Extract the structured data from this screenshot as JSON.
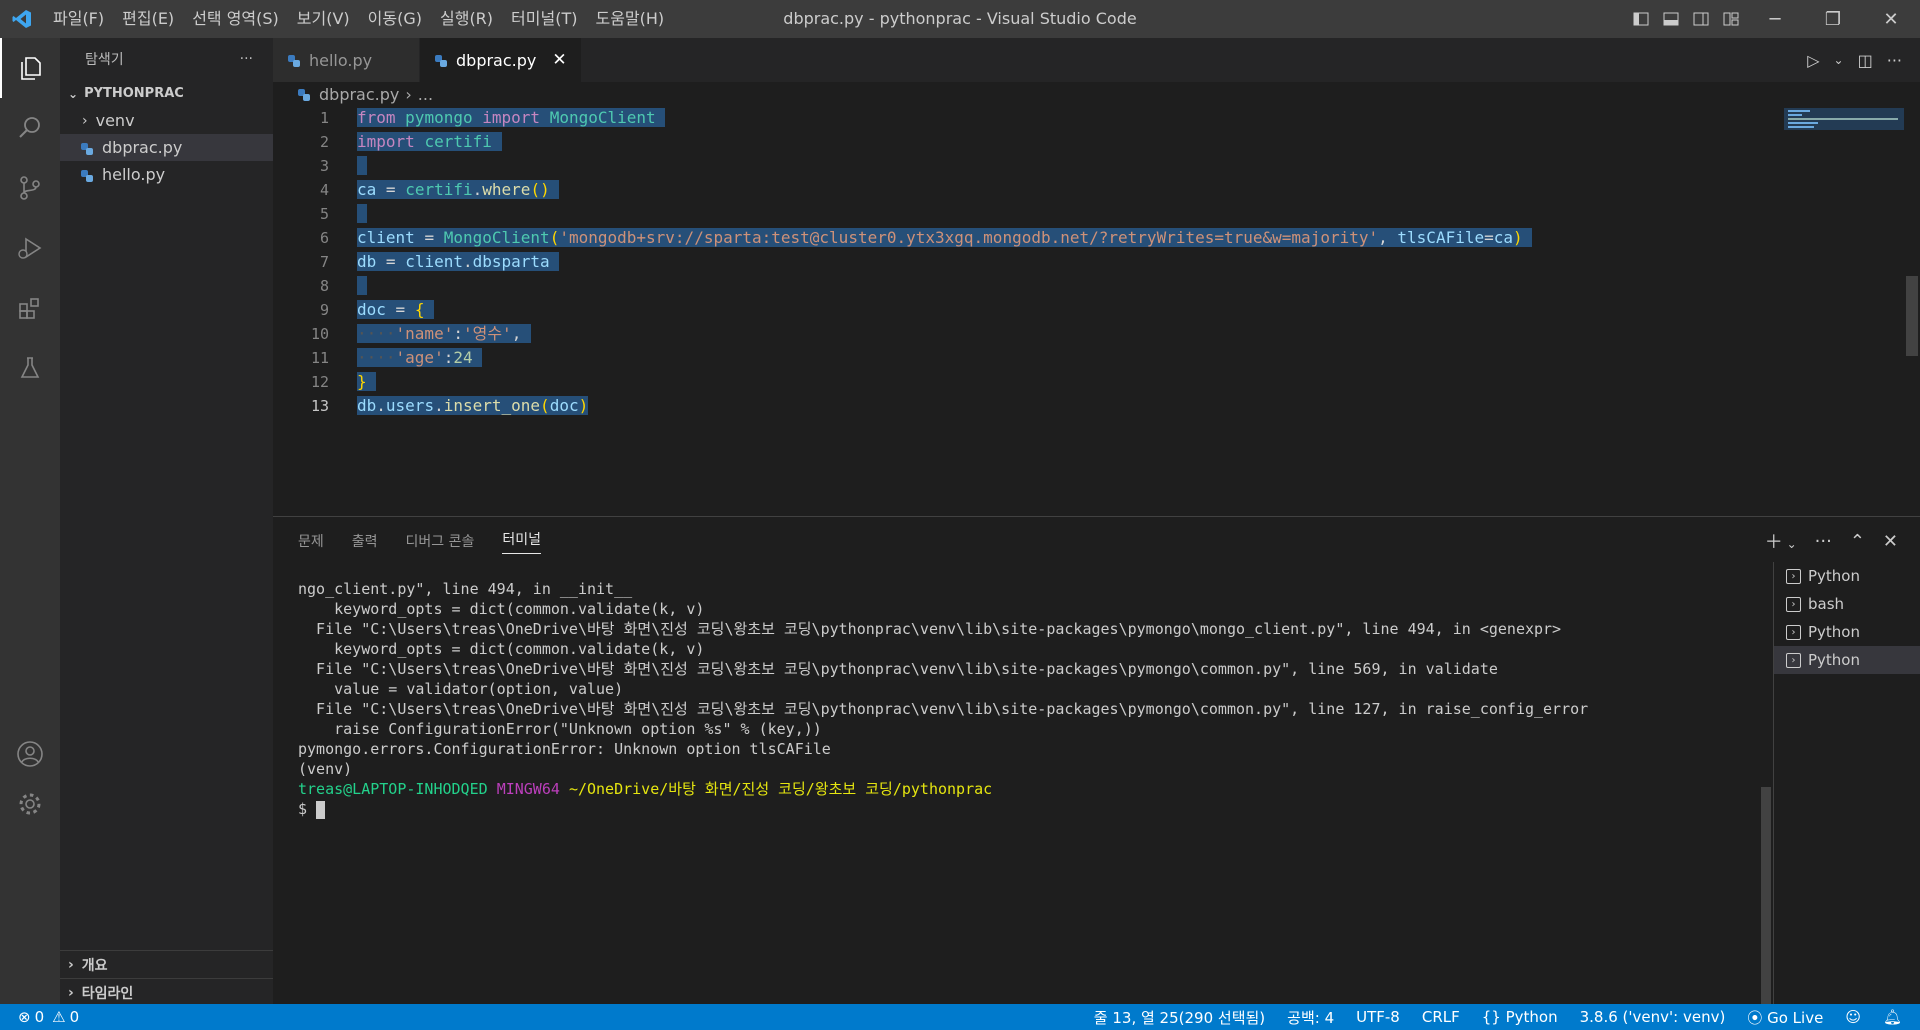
{
  "window": {
    "title": "dbprac.py - pythonprac - Visual Studio Code",
    "menu": [
      "파일(F)",
      "편집(E)",
      "선택 영역(S)",
      "보기(V)",
      "이동(G)",
      "실행(R)",
      "터미널(T)",
      "도움말(H)"
    ]
  },
  "sidebar": {
    "title": "탐색기",
    "more": "···",
    "root": "PYTHONPRAC",
    "items": [
      {
        "label": "venv",
        "kind": "folder"
      },
      {
        "label": "dbprac.py",
        "kind": "python",
        "selected": true
      },
      {
        "label": "hello.py",
        "kind": "python"
      }
    ],
    "bottom": [
      "개요",
      "타임라인"
    ]
  },
  "tabs": [
    {
      "label": "hello.py",
      "active": false
    },
    {
      "label": "dbprac.py",
      "active": true,
      "close": "✕"
    }
  ],
  "breadcrumb": {
    "file": "dbprac.py",
    "sep": "›",
    "rest": "..."
  },
  "editor": {
    "line_numbers": [
      "1",
      "2",
      "3",
      "4",
      "5",
      "6",
      "7",
      "8",
      "9",
      "10",
      "11",
      "12",
      "13"
    ],
    "current_line": "13"
  },
  "panel": {
    "tabs": [
      "문제",
      "출력",
      "디버그 콘솔",
      "터미널"
    ],
    "active_tab": "터미널",
    "terminal_lines": [
      "ngo_client.py\", line 494, in __init__",
      "    keyword_opts = dict(common.validate(k, v)",
      "  File \"C:\\Users\\treas\\OneDrive\\바탕 화면\\진성 코딩\\왕초보 코딩\\pythonprac\\venv\\lib\\site-packages\\pymongo\\mongo_client.py\", line 494, in <genexpr>",
      "    keyword_opts = dict(common.validate(k, v)",
      "  File \"C:\\Users\\treas\\OneDrive\\바탕 화면\\진성 코딩\\왕초보 코딩\\pythonprac\\venv\\lib\\site-packages\\pymongo\\common.py\", line 569, in validate",
      "    value = validator(option, value)",
      "  File \"C:\\Users\\treas\\OneDrive\\바탕 화면\\진성 코딩\\왕초보 코딩\\pythonprac\\venv\\lib\\site-packages\\pymongo\\common.py\", line 127, in raise_config_error",
      "    raise ConfigurationError(\"Unknown option %s\" % (key,))",
      "pymongo.errors.ConfigurationError: Unknown option tlsCAFile",
      "(venv)"
    ],
    "prompt": {
      "user": "treas@LAPTOP-INHODQED",
      "shell": "MINGW64",
      "path": "~/OneDrive/바탕 화면/진성 코딩/왕초보 코딩/pythonprac",
      "symbol": "$"
    },
    "terminals": [
      {
        "label": "Python",
        "selected": false
      },
      {
        "label": "bash",
        "selected": false
      },
      {
        "label": "Python",
        "selected": false
      },
      {
        "label": "Python",
        "selected": true
      }
    ]
  },
  "status": {
    "errors": "0",
    "warnings": "0",
    "position": "줄 13, 열 25(290 선택됨)",
    "spaces": "공백: 4",
    "encoding": "UTF-8",
    "eol": "CRLF",
    "language": "Python",
    "interpreter": "3.8.6 ('venv': venv)",
    "golive": "Go Live"
  },
  "colors": {
    "accent": "#007acc",
    "selection": "#264f78"
  }
}
